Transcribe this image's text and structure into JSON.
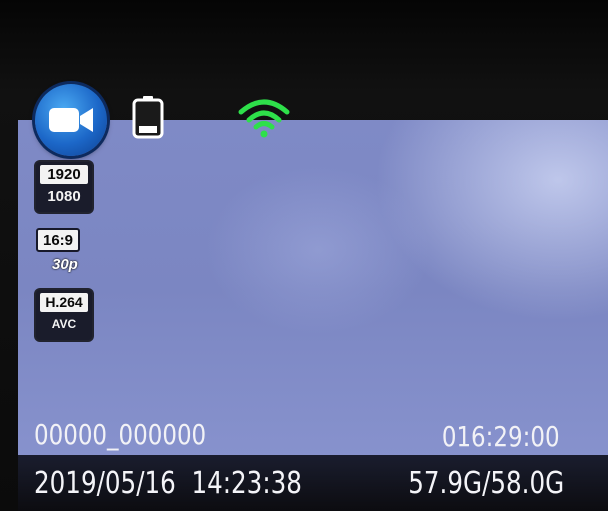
{
  "mode": {
    "icon": "video-camera-icon",
    "accent_color": "#1f6fd0"
  },
  "status": {
    "battery_icon": "battery-low-icon",
    "wifi_icon": "wifi-icon",
    "wifi_color": "#2ee04a"
  },
  "video_settings": {
    "resolution_top": "1920",
    "resolution_bottom": "1080",
    "aspect_ratio": "16:9",
    "frame_rate": "30p",
    "codec_top": "H.264",
    "codec_bottom": "AVC"
  },
  "overlay": {
    "filename": "00000_000000",
    "recording_time": "016:29:00",
    "date": "2019/05/16",
    "time": "14:23:38",
    "storage": "57.9G/58.0G"
  }
}
